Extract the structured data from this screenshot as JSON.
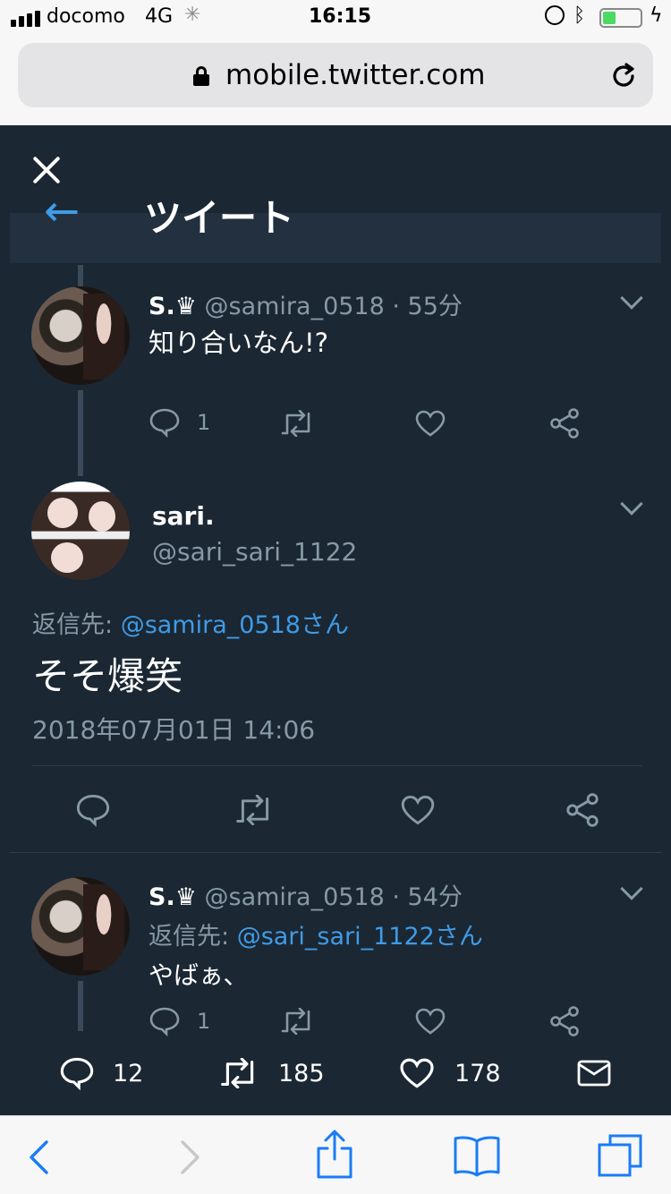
{
  "status": {
    "carrier": "docomo",
    "network": "4G",
    "time": "16:15"
  },
  "url": "mobile.twitter.com",
  "header_title": "ツイート",
  "tweets": [
    {
      "name": "S.♛",
      "handle": "@samira_0518",
      "time": "· 55分",
      "text": "知り合いなん!?",
      "replies": "1"
    },
    {
      "name": "sari.",
      "handle": "@sari_sari_1122",
      "reply_prefix": "返信先: ",
      "reply_to": "@samira_0518さん",
      "text": "そそ爆笑",
      "date": "2018年07月01日 14:06"
    },
    {
      "name": "S.♛",
      "handle": "@samira_0518",
      "time": "· 54分",
      "reply_prefix": "返信先: ",
      "reply_to": "@sari_sari_1122さん",
      "text": "やばぁ、",
      "replies": "1"
    }
  ],
  "footer": {
    "replies": "12",
    "retweets": "185",
    "likes": "178"
  },
  "colors": {
    "background": "#1b2733",
    "link": "#3f9be6",
    "muted": "#8899a6"
  }
}
